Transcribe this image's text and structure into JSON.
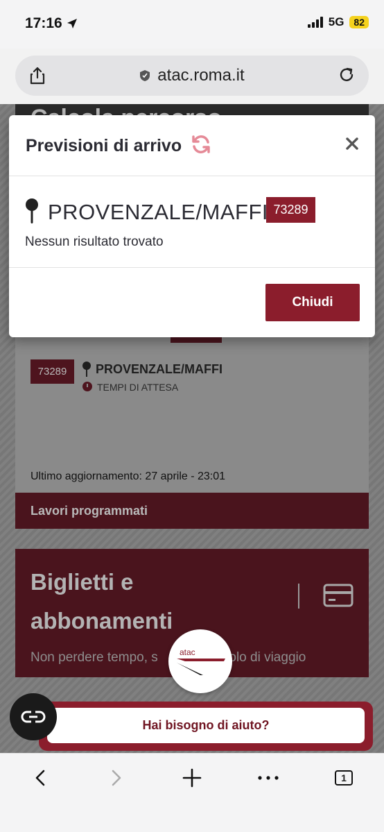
{
  "status_bar": {
    "time": "17:16",
    "network": "5G",
    "battery": "82"
  },
  "browser": {
    "url": "atac.roma.it",
    "tabs_count": "1"
  },
  "background_page": {
    "section_heading": "Calcola percorso",
    "stop_code": "73289",
    "stop_name": "PROVENZALE/MAFFI",
    "waiting_label": "TEMPI DI ATTESA",
    "last_update": "Ultimo aggiornamento: 27 aprile - 23:01",
    "works_label": "Lavori programmati",
    "tickets_title": "Biglietti e abbonamenti",
    "tickets_subtitle": "Non perdere tempo, s",
    "tickets_subtitle_end": "o titolo di viaggio",
    "logo_text": "atac"
  },
  "help": {
    "label": "Hai bisogno di aiuto?"
  },
  "modal": {
    "title": "Previsioni di arrivo",
    "stop_name": "PROVENZALE/MAFFI",
    "stop_code": "73289",
    "no_result": "Nessun risultato trovato",
    "close_label": "Chiudi"
  },
  "colors": {
    "brand": "#8b1d2c",
    "modal_bg": "#ffffff",
    "refresh_icon": "#e58a97"
  },
  "icons": [
    "location-arrow-icon",
    "share-icon",
    "shield-icon",
    "reload-icon",
    "refresh-icon",
    "close-icon",
    "map-pin-icon",
    "clock-icon",
    "credit-card-icon",
    "accessibility-icon",
    "back-icon",
    "forward-icon",
    "plus-icon",
    "more-icon",
    "tabs-icon"
  ]
}
